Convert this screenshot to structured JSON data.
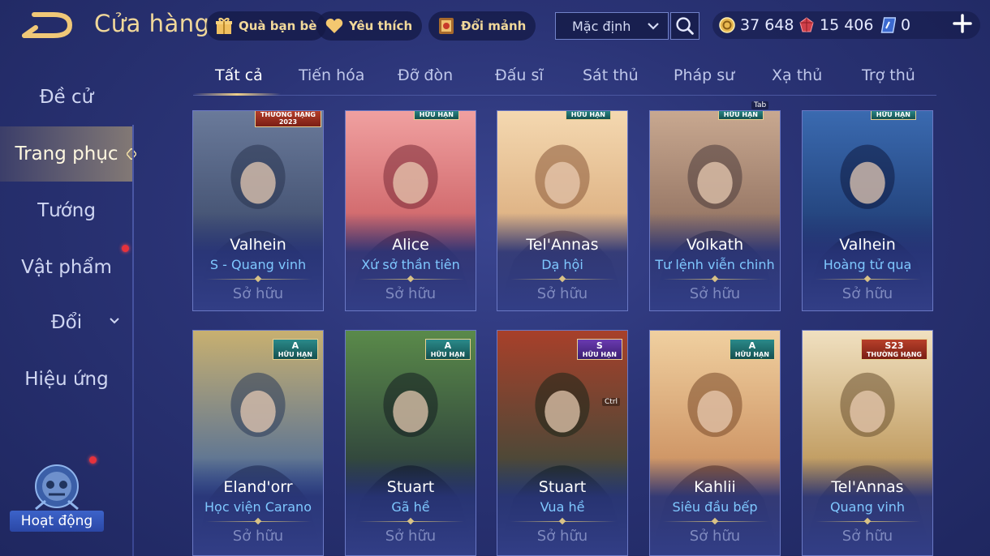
{
  "header": {
    "title": "Cửa hàng",
    "buttons": [
      {
        "label": "Quà bạn bè",
        "icon": "gift-icon"
      },
      {
        "label": "Yêu thích",
        "icon": "heart-icon"
      },
      {
        "label": "Đổi mảnh",
        "icon": "shard-book-icon"
      }
    ],
    "sort": {
      "value": "Mặc định"
    },
    "currencies": [
      {
        "icon": "gold-coin-icon",
        "value": "37 648"
      },
      {
        "icon": "red-gem-icon",
        "value": "15 406"
      },
      {
        "icon": "voucher-icon",
        "value": "0"
      }
    ]
  },
  "sidebar": {
    "items": [
      {
        "label": "Đề cử"
      },
      {
        "label": "Trang phục"
      },
      {
        "label": "Tướng"
      },
      {
        "label": "Vật phẩm"
      },
      {
        "label": "Đổi"
      },
      {
        "label": "Hiệu ứng"
      }
    ],
    "activity_label": "Hoạt động"
  },
  "tabs": [
    {
      "label": "Tất cả"
    },
    {
      "label": "Tiến hóa"
    },
    {
      "label": "Đỡ đòn"
    },
    {
      "label": "Đấu sĩ"
    },
    {
      "label": "Sát thủ"
    },
    {
      "label": "Pháp sư"
    },
    {
      "label": "Xạ thủ"
    },
    {
      "label": "Trợ thủ"
    }
  ],
  "key_hints": {
    "tab": "Tab",
    "ctrl": "Ctrl"
  },
  "cards": [
    {
      "hero": "Valhein",
      "skin": "S - Quang vinh",
      "status": "Sở hữu",
      "badge_line1": "THƯỜNG HẠNG",
      "badge_line2": "2023"
    },
    {
      "hero": "Alice",
      "skin": "Xứ sở thần tiên",
      "status": "Sở hữu",
      "badge_line1": "HỮU HẠN",
      "badge_line2": ""
    },
    {
      "hero": "Tel'Annas",
      "skin": "Dạ hội",
      "status": "Sở hữu",
      "badge_line1": "HỮU HẠN",
      "badge_line2": ""
    },
    {
      "hero": "Volkath",
      "skin": "Tư lệnh viễn chinh",
      "status": "Sở hữu",
      "badge_line1": "HỮU HẠN",
      "badge_line2": ""
    },
    {
      "hero": "Valhein",
      "skin": "Hoàng tử quạ",
      "status": "Sở hữu",
      "badge_line1": "HỮU HẠN",
      "badge_line2": ""
    },
    {
      "hero": "Eland'orr",
      "skin": "Học viện Carano",
      "status": "Sở hữu",
      "badge_line1": "A",
      "badge_line2": "HỮU HẠN"
    },
    {
      "hero": "Stuart",
      "skin": "Gã hề",
      "status": "Sở hữu",
      "badge_line1": "A",
      "badge_line2": "HỮU HẠN"
    },
    {
      "hero": "Stuart",
      "skin": "Vua hề",
      "status": "Sở hữu",
      "badge_line1": "S",
      "badge_line2": "HỮU HẠN"
    },
    {
      "hero": "Kahlii",
      "skin": "Siêu đầu bếp",
      "status": "Sở hữu",
      "badge_line1": "A",
      "badge_line2": "HỮU HẠN"
    },
    {
      "hero": "Tel'Annas",
      "skin": "Quang vinh",
      "status": "Sở hữu",
      "badge_line1": "S23",
      "badge_line2": "THƯỜNG HẠNG"
    }
  ],
  "colors": {
    "accent_gold": "#f1d89a",
    "skin_name": "#7fc8ff",
    "notification": "#e6323c"
  }
}
